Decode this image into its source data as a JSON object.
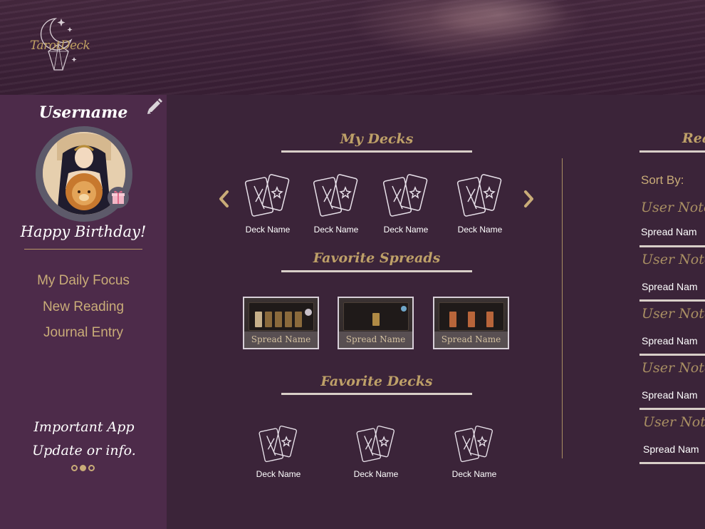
{
  "header": {
    "logo_text": "TarotDeck"
  },
  "sidebar": {
    "username": "Username",
    "greeting": "Happy Birthday!",
    "nav": [
      {
        "label": "My Daily Focus"
      },
      {
        "label": "New Reading"
      },
      {
        "label": "Journal Entry"
      }
    ],
    "announcement_line1": "Important App",
    "announcement_line2": "Update or info.",
    "carousel_active_index": 1,
    "carousel_count": 3
  },
  "my_decks": {
    "title": "My Decks",
    "items": [
      {
        "name": "Deck Name"
      },
      {
        "name": "Deck Name"
      },
      {
        "name": "Deck Name"
      },
      {
        "name": "Deck Name"
      }
    ]
  },
  "favorite_spreads": {
    "title": "Favorite Spreads",
    "items": [
      {
        "name": "Spread Name"
      },
      {
        "name": "Spread Name"
      },
      {
        "name": "Spread Name"
      }
    ]
  },
  "favorite_decks": {
    "title": "Favorite Decks",
    "items": [
      {
        "name": "Deck Name"
      },
      {
        "name": "Deck Name"
      },
      {
        "name": "Deck Name"
      }
    ]
  },
  "readings": {
    "title": "Rea",
    "sort_label": "Sort By:",
    "items": [
      {
        "note": "User Notes",
        "spread": "Spread Nam"
      },
      {
        "note": "User Notes",
        "spread": "Spread Nam"
      },
      {
        "note": "User Notes",
        "spread": "Spread Nam"
      },
      {
        "note": "User Notes",
        "spread": "Spread Nam"
      },
      {
        "note": "User Notes",
        "spread": "Spread Nam"
      }
    ]
  },
  "colors": {
    "background": "#3b2439",
    "sidebar": "#4d2b4a",
    "gold": "#c9ac78",
    "rule": "#d8cfc8"
  }
}
